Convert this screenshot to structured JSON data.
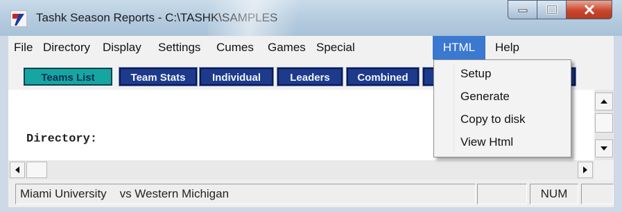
{
  "window": {
    "title": "Tashk Season Reports - C:\\TASHK\\SAMPLES",
    "icon": "app-icon",
    "controls": [
      "minimize-icon",
      "maximize-icon",
      "close-icon"
    ]
  },
  "menubar": {
    "items": [
      {
        "label": "File"
      },
      {
        "label": "Directory"
      },
      {
        "label": "Display"
      },
      {
        "label": "Settings"
      },
      {
        "label": "Cumes"
      },
      {
        "label": "Games"
      },
      {
        "label": "Special"
      },
      {
        "label": "HTML",
        "active": true
      },
      {
        "label": "Help"
      }
    ]
  },
  "toolbar": {
    "buttons": [
      {
        "label": "Teams List",
        "style": "teal"
      },
      {
        "label": "Team Stats",
        "style": "blue"
      },
      {
        "label": "Individual",
        "style": "blue"
      },
      {
        "label": "Leaders",
        "style": "blue"
      },
      {
        "label": "Combined",
        "style": "blue"
      }
    ]
  },
  "html_menu": {
    "items": [
      "Setup",
      "Generate",
      "Copy to disk",
      "View Html"
    ]
  },
  "content": {
    "directory_label": "Directory:"
  },
  "statusbar": {
    "message": "Miami University    vs Western Michigan",
    "indicator": "NUM"
  },
  "colors": {
    "accent_menu": "#3b78d0",
    "toolbar_teal": "#16a6a0",
    "toolbar_blue": "#1d3a8c",
    "close_red": "#c9462c"
  }
}
